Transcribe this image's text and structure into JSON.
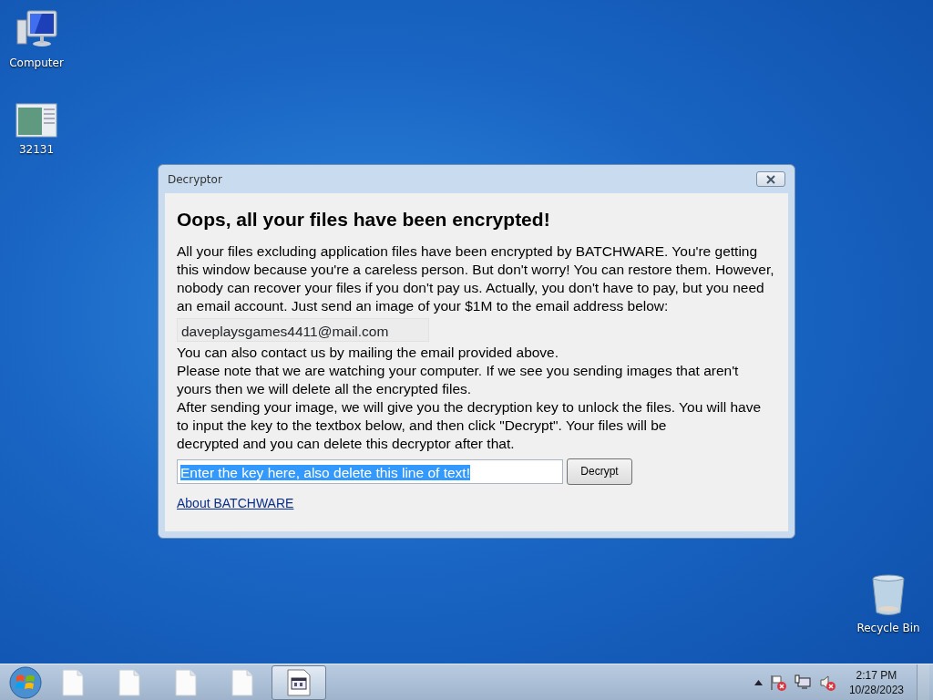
{
  "desktop_icons": [
    {
      "kind": "computer",
      "label": "Computer"
    },
    {
      "kind": "app",
      "label": "32131"
    },
    {
      "kind": "recycle",
      "label": "Recycle Bin"
    }
  ],
  "window": {
    "title": "Decryptor",
    "heading": "Oops, all your files have been encrypted!",
    "paragraphs_before": [
      {
        "lines": [
          "All your files excluding application files have been encrypted by BATCHWARE. You're getting",
          "this window because you're a careless person. But don't worry! You can restore them. However,",
          "nobody can recover your files if you don't pay us. Actually, you don't have to pay, but you need",
          "an email account. Just send an image of your $1M to the email address below:"
        ]
      }
    ],
    "email_field": {
      "value": "daveplaysgames4411@mail.com"
    },
    "paragraphs_after": [
      {
        "lines": [
          "You can also contact us by mailing the email provided above."
        ]
      },
      {
        "lines": [
          "Please note that we are watching your computer. If we see you sending images that aren't",
          "yours then we will delete all the encrypted files."
        ]
      },
      {
        "lines": [
          "After sending your image, we will give you the decryption key to unlock the files. You will have",
          "to input the key to the textbox below, and then click \"Decrypt\". Your files will be",
          "decrypted and you can delete this decryptor after that."
        ]
      }
    ],
    "key_field": {
      "value": "Enter the key here, also delete this line of text!",
      "text_selected": true
    },
    "decrypt_button": "Decrypt",
    "about_link": "About BATCHWARE"
  },
  "taskbar": {
    "items": [
      {
        "kind": "file",
        "selected": false
      },
      {
        "kind": "file",
        "selected": false
      },
      {
        "kind": "file",
        "selected": false
      },
      {
        "kind": "file",
        "selected": false
      },
      {
        "kind": "app",
        "selected": true
      }
    ],
    "tray": {
      "flag_error": true,
      "network_error": false,
      "volume_muted": true
    },
    "time": "2:17 PM",
    "date": "10/28/2023"
  }
}
